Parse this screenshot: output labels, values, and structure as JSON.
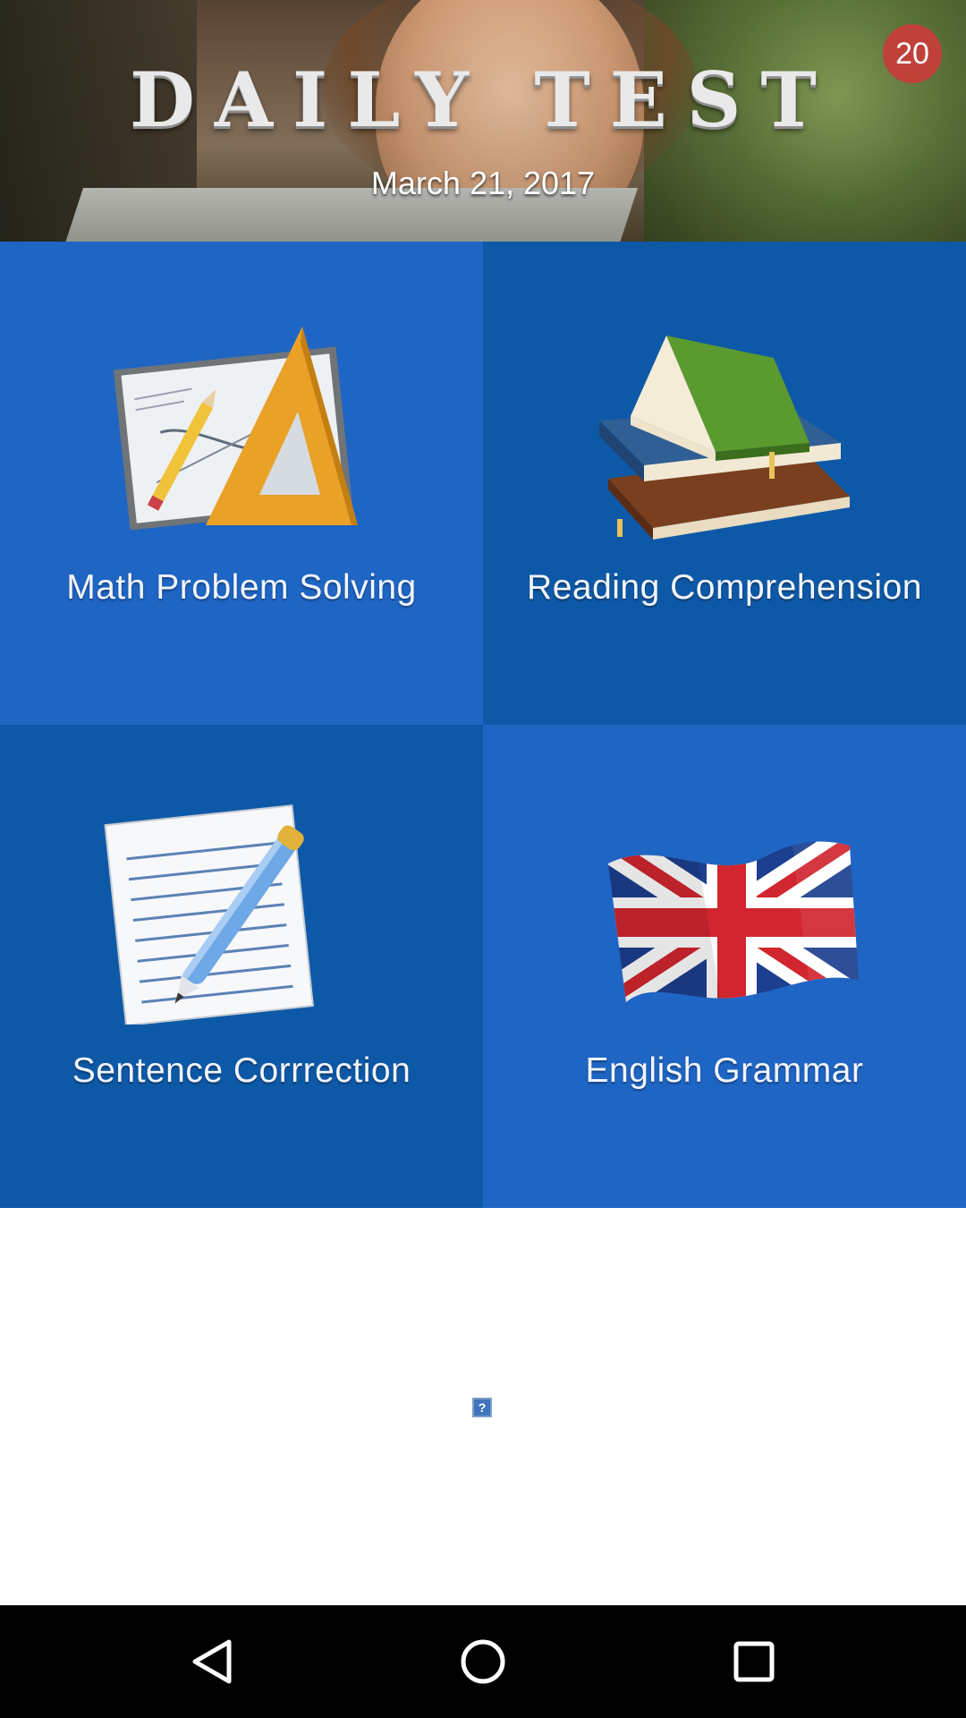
{
  "header": {
    "title": "Daily Test",
    "date": "March 21, 2017",
    "badge_count": "20",
    "badge_color": "#c0403a"
  },
  "tiles": [
    {
      "label": "Math Problem Solving",
      "icon": "drafting-triangle-icon",
      "color": "#1f65c4"
    },
    {
      "label": "Reading Comprehension",
      "icon": "books-stack-icon",
      "color": "#0e59a7"
    },
    {
      "label": "Sentence Corrrection",
      "icon": "document-pen-icon",
      "color": "#0e59a7"
    },
    {
      "label": "English Grammar",
      "icon": "union-jack-flag-icon",
      "color": "#1f65c4"
    }
  ],
  "ad": {
    "icon": "broken-image-icon",
    "glyph": "?"
  },
  "navbar": {
    "back_icon": "back-triangle-icon",
    "home_icon": "home-circle-icon",
    "recents_icon": "recents-square-icon"
  }
}
